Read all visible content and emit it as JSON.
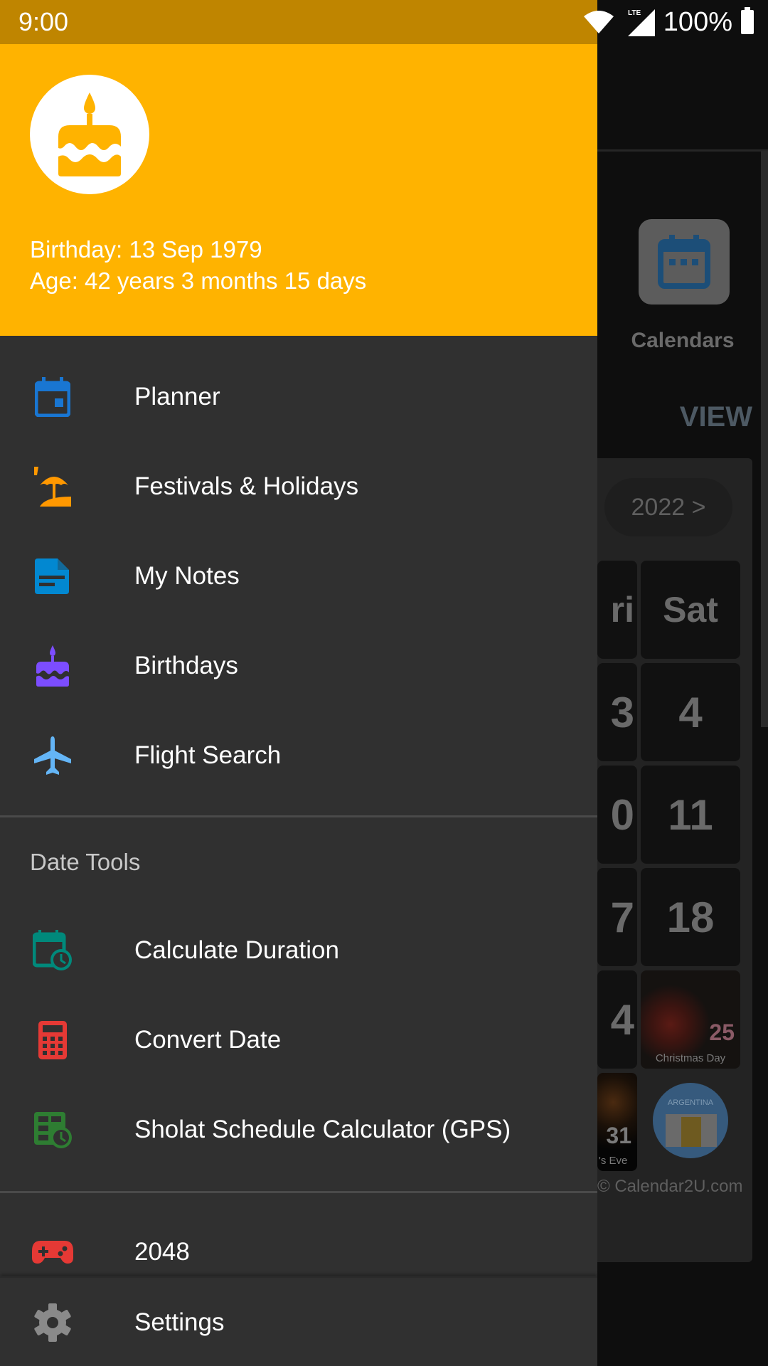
{
  "status_bar": {
    "time": "9:00",
    "network": "LTE",
    "battery": "100%",
    "icons": [
      "wifi-icon",
      "signal-icon",
      "battery-icon"
    ]
  },
  "drawer": {
    "header": {
      "avatar_icon": "cake-icon",
      "birthday": "Birthday: 13 Sep 1979",
      "age": "Age: 42 years 3 months 15 days",
      "background_color": "#ffb300"
    },
    "main_items": [
      {
        "label": "Planner",
        "icon": "calendar-icon",
        "color": "#1976d2"
      },
      {
        "label": "Festivals & Holidays",
        "icon": "beach-umbrella-icon",
        "color": "#ff9800"
      },
      {
        "label": "My Notes",
        "icon": "note-icon",
        "color": "#0288d1"
      },
      {
        "label": "Birthdays",
        "icon": "cake-icon",
        "color": "#7c4dff"
      },
      {
        "label": "Flight Search",
        "icon": "airplane-icon",
        "color": "#64b5f6"
      }
    ],
    "date_tools": {
      "title": "Date Tools",
      "items": [
        {
          "label": "Calculate Duration",
          "icon": "calendar-clock-icon",
          "color": "#00897b"
        },
        {
          "label": "Convert Date",
          "icon": "calculator-icon",
          "color": "#e53935"
        },
        {
          "label": "Sholat Schedule Calculator (GPS)",
          "icon": "schedule-clock-icon",
          "color": "#2e7d32"
        }
      ]
    },
    "extra_items": [
      {
        "label": "2048",
        "icon": "gamepad-icon",
        "color": "#e53935"
      }
    ],
    "footer": {
      "label": "Settings",
      "icon": "gear-icon",
      "color": "#8a8a8a"
    }
  },
  "background_app": {
    "calendars_label": "Calendars",
    "view_label": "VIEW",
    "year_button": "2022 >",
    "weekday_partial": "ri",
    "weekday_sat": "Sat",
    "days": {
      "partial_col": [
        "3",
        "0",
        "7",
        "4"
      ],
      "sat_col": [
        "4",
        "11",
        "18"
      ]
    },
    "christmas": {
      "day": "25",
      "caption": "Christmas Day"
    },
    "new_years_eve": {
      "day": "31",
      "caption": "'s Eve"
    },
    "badge_title": "ARGENTINA",
    "copyright": "© Calendar2U.com"
  }
}
